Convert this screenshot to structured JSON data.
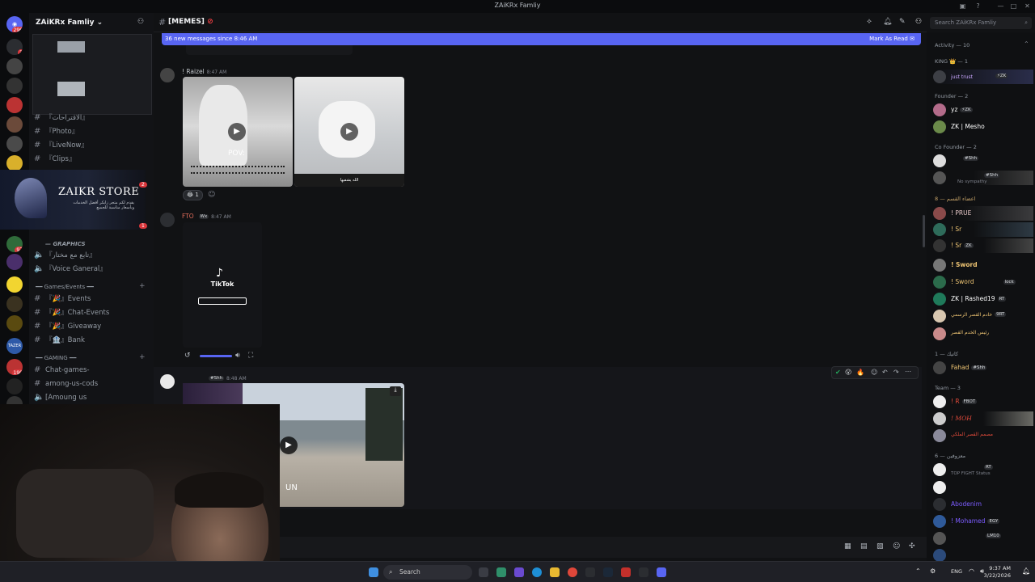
{
  "window": {
    "title": "ZAiKRx Famliy"
  },
  "rail": {
    "top_badge": "296",
    "servers": [
      {
        "label": "",
        "badge": "3"
      },
      {
        "label": "",
        "badge": ""
      },
      {
        "label": "",
        "badge": ""
      },
      {
        "label": "",
        "badge": ""
      },
      {
        "label": "",
        "badge": ""
      },
      {
        "label": "",
        "badge": ""
      },
      {
        "label": "",
        "badge": ""
      },
      {
        "label": "",
        "badge": ""
      }
    ],
    "lower": [
      {
        "label": "",
        "badge": "97"
      },
      {
        "label": "",
        "badge": ""
      },
      {
        "label": "",
        "badge": ""
      },
      {
        "label": "",
        "badge": ""
      },
      {
        "label": "",
        "badge": ""
      },
      {
        "label": "TAZER",
        "badge": ""
      },
      {
        "label": "",
        "badge": "190"
      },
      {
        "label": "",
        "badge": ""
      },
      {
        "label": "",
        "badge": ""
      }
    ]
  },
  "sidebar": {
    "guild_name": "ZAiKRx Famliy",
    "channels_top": [
      {
        "name": "『الاقتراحات』",
        "icon": "hash-icon"
      },
      {
        "name": "『Photo』",
        "icon": "hash-icon"
      },
      {
        "name": "『LiveNow』",
        "icon": "hash-icon"
      },
      {
        "name": "『Clips』",
        "icon": "hash-icon"
      }
    ],
    "banner": {
      "title": "ZAIKR STORE",
      "subtitle": "يقدم لكم متجر زايكر أفضل الخدمات وبأسعار مناسبة للجميع"
    },
    "banner_badges": [
      "2",
      "1"
    ],
    "graphics_cat": "GRAPHICS",
    "voice": [
      {
        "name": "『تابع مع مختار』",
        "icon": "speaker-icon"
      },
      {
        "name": "『Voice Ganeral』",
        "icon": "speaker-icon"
      }
    ],
    "cat_games": "Games/Events",
    "games": [
      {
        "name": "『🎉』Events",
        "icon": "hash-icon"
      },
      {
        "name": "『🎉』Chat-Events",
        "icon": "hash-icon"
      },
      {
        "name": "『🎉』Giveaway",
        "icon": "hash-icon"
      },
      {
        "name": "『🏦』Bank",
        "icon": "hash-icon"
      }
    ],
    "cat_gaming": "GAMING",
    "gaming": [
      {
        "name": "Chat-games-",
        "icon": "hash-icon"
      },
      {
        "name": "among-us-cods",
        "icon": "hash-icon"
      },
      {
        "name": "[Amoung us",
        "icon": "speaker-icon"
      }
    ]
  },
  "header": {
    "channel": "[MEMES]"
  },
  "new_messages": {
    "text": "36 new messages since 8:46 AM",
    "action": "Mark As Read"
  },
  "messages": [
    {
      "author": "! Raizel",
      "time": "8:47 AM",
      "caption_pov": "POV:",
      "caption_right": "الله يشفيها",
      "reaction": "1"
    },
    {
      "author": "FTO",
      "tag": "Wx",
      "time": "8:47 AM",
      "video_brand": "TikTok"
    },
    {
      "author": "",
      "tag": "#Shh",
      "time": "8:48 AM",
      "video_caption": "UN"
    }
  ],
  "members": {
    "search_placeholder": "Search ZAiKRx Famliy",
    "activity": "Activity — 10",
    "groups": [
      {
        "title": "KING 👑 — 1",
        "members": [
          {
            "name": "",
            "sub": "just trust",
            "tag": "⚡ZK",
            "color": "#c9a7ff"
          }
        ]
      },
      {
        "title": "Founder — 2",
        "members": [
          {
            "name": "yz",
            "tag": "⚡ZK",
            "color": "#ffffff"
          },
          {
            "name": "ZK | Mesho",
            "tag": "",
            "color": "#ffffff"
          }
        ]
      },
      {
        "title": "Co Founder — 2",
        "members": [
          {
            "name": "",
            "tag": "#Shh",
            "sub": "",
            "color": "#ffffff"
          },
          {
            "name": "",
            "tag": "#Shh",
            "sub": "No sympathy",
            "color": "#ffffff"
          }
        ]
      },
      {
        "title": "اعضاء القسم — 8",
        "members": [
          {
            "name": "! PRUE",
            "tag": "",
            "color": "#e6c7c7"
          },
          {
            "name": "! Sr",
            "tag": "",
            "color": "#f0c674"
          },
          {
            "name": "! Sr",
            "tag": "ZK",
            "color": "#f0c674"
          },
          {
            "name": "! Sword",
            "tag": "",
            "color": "#f0c674"
          },
          {
            "name": "! Sword",
            "tag": "lock",
            "color": "#f0c674"
          },
          {
            "name": "ZK | Rashed19",
            "tag": "RT",
            "color": "#ffffff"
          },
          {
            "name": "خادم القصر الرسمي",
            "tag": "9RT",
            "color": "#f0c674"
          },
          {
            "name": "رئيس الخدم القصر",
            "tag": "",
            "color": "#f0c674"
          }
        ]
      },
      {
        "title": "كاتيك — 1",
        "members": [
          {
            "name": "Fahad",
            "tag": "#Shh",
            "color": "#f0c674"
          }
        ]
      },
      {
        "title": "Team — 3",
        "members": [
          {
            "name": "! R",
            "tag": "FBOT",
            "color": "#e74c3c"
          },
          {
            "name": "! MOH",
            "tag": "",
            "color": "#e74c3c"
          },
          {
            "name": "مصمم القصر الملكي",
            "tag": "",
            "color": "#e74c3c"
          }
        ]
      },
      {
        "title": "معزوفين — 6",
        "members": [
          {
            "name": "",
            "tag": "RT",
            "sub": "TOP FIGHT Status",
            "color": "#7c5cff"
          },
          {
            "name": "",
            "tag": "",
            "color": "#7c5cff"
          },
          {
            "name": "Abodenim",
            "tag": "",
            "color": "#7c5cff"
          },
          {
            "name": "! Mohamed",
            "tag": "EGY",
            "color": "#7c5cff"
          },
          {
            "name": "",
            "tag": "LM10",
            "color": "#7c5cff"
          },
          {
            "name": "",
            "tag": "",
            "color": "#7c5cff"
          }
        ]
      }
    ]
  },
  "taskbar": {
    "search": "Search",
    "lang": "ENG",
    "time": "9:37 AM",
    "date": "3/22/2026"
  }
}
